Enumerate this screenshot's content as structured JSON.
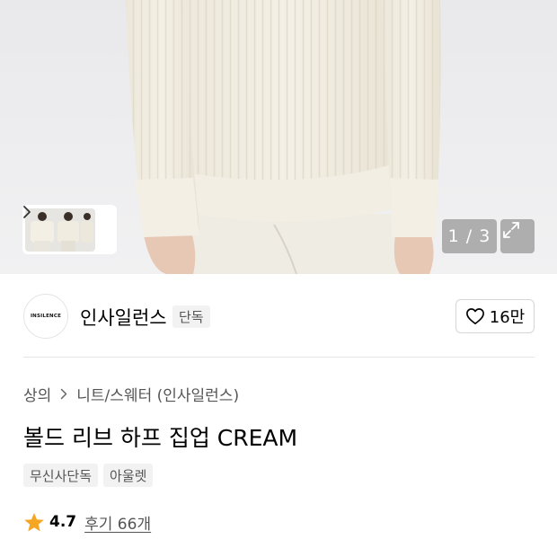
{
  "gallery": {
    "counter": "1 / 3",
    "thumbnails_next": "next-thumbnails"
  },
  "brand": {
    "logo_text": "INSILENCE",
    "name": "인사일런스",
    "tag": "단독"
  },
  "like": {
    "count": "16만"
  },
  "breadcrumb": {
    "items": [
      "상의",
      "니트/스웨터 (인사일런스)"
    ]
  },
  "product": {
    "title": "볼드 리브 하프 집업 CREAM",
    "tags": [
      "무신사단독",
      "아울렛"
    ]
  },
  "rating": {
    "value": "4.7",
    "reviews_label": "후기 66개"
  },
  "colors": {
    "star": "#F5A623",
    "tag_bg": "#F2F2F2",
    "sweater": "#F1EDE2"
  }
}
